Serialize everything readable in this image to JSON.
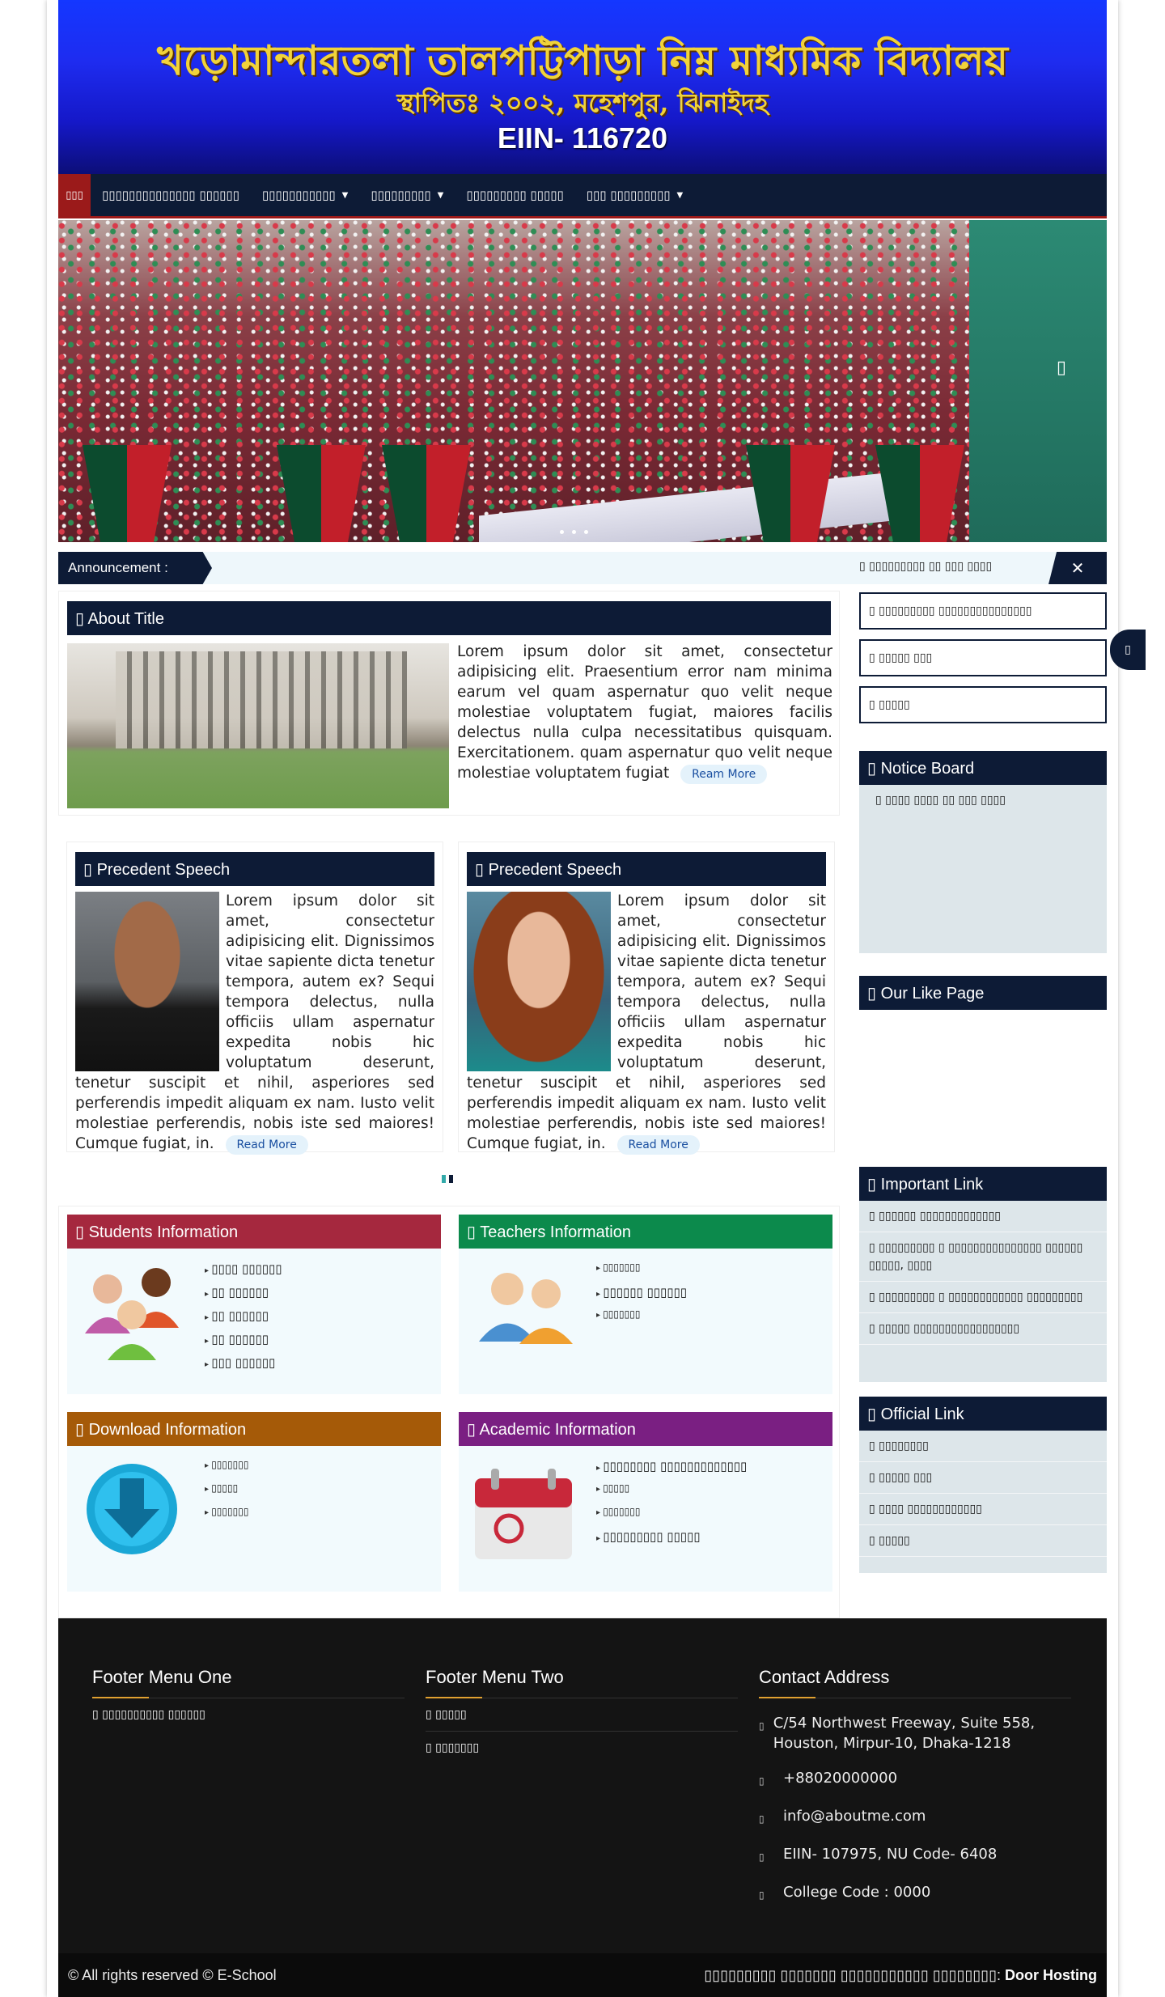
{
  "header": {
    "school_name": "খড়োমান্দারতলা তালপট্টিপাড়া নিম্ন মাধ্যমিক বিদ্যালয়",
    "established": "স্থাপিতঃ ২০০২, মহেশপুর, ঝিনাইদহ",
    "eiin": "EIIN- 116720"
  },
  "nav": {
    "home": "▯▯▯",
    "items": [
      {
        "label": "▯▯▯▯▯▯▯▯▯▯▯▯▯▯ ▯▯▯▯▯▯"
      },
      {
        "label": "▯▯▯▯▯▯▯▯▯▯▯",
        "caret": "▼"
      },
      {
        "label": "▯▯▯▯▯▯▯▯▯",
        "caret": "▼"
      },
      {
        "label": "▯▯▯▯▯▯▯▯▯ ▯▯▯▯▯"
      },
      {
        "label": "▯▯▯ ▯▯▯▯▯▯▯▯▯",
        "caret": "▼"
      }
    ]
  },
  "slider": {
    "next_icon": "▯"
  },
  "announcement": {
    "label": "Announcement :",
    "ticker": "▯ ▯▯▯▯▯▯▯▯▯ ▯▯ ▯▯▯ ▯▯▯▯",
    "close": "✕"
  },
  "about": {
    "title": "▯ About Title",
    "text": "Lorem ipsum dolor sit amet, consectetur adipisicing elit. Praesentium error nam minima earum vel quam aspernatur quo velit neque molestiae voluptatem fugiat, maiores facilis delectus nulla culpa necessitatibus quisquam. Exercitationem. quam aspernatur quo velit neque molestiae voluptatem fugiat",
    "read_more": "Ream More"
  },
  "speeches": [
    {
      "title": "▯ Precedent Speech",
      "text": "Lorem ipsum dolor sit amet, consectetur adipisicing elit. Dignissimos vitae sapiente dicta tenetur tempora, autem ex? Sequi tempora delectus, nulla officiis ullam aspernatur expedita nobis hic voluptatum deserunt, tenetur suscipit et nihil, asperiores sed perferendis impedit aliquam ex nam. Iusto velit molestiae perferendis, nobis iste sed maiores! Cumque fugiat, in.",
      "read_more": "Read More"
    },
    {
      "title": "▯ Precedent Speech",
      "text": "Lorem ipsum dolor sit amet, consectetur adipisicing elit. Dignissimos vitae sapiente dicta tenetur tempora, autem ex? Sequi tempora delectus, nulla officiis ullam aspernatur expedita nobis hic voluptatum deserunt, tenetur suscipit et nihil, asperiores sed perferendis impedit aliquam ex nam. Iusto velit molestiae perferendis, nobis iste sed maiores! Cumque fugiat, in.",
      "read_more": "Read More"
    }
  ],
  "info_cards": {
    "students": {
      "title": "▯ Students Information",
      "color": "#a5283e",
      "items": [
        "▯▯▯▯ ▯▯▯▯▯▯",
        "▯▯ ▯▯▯▯▯▯",
        "▯▯ ▯▯▯▯▯▯",
        "▯▯ ▯▯▯▯▯▯",
        "▯▯▯ ▯▯▯▯▯▯"
      ]
    },
    "teachers": {
      "title": "▯ Teachers Information",
      "color": "#0c8a4c",
      "items": [
        "▯▯▯▯▯▯▯",
        "▯▯▯▯▯▯ ▯▯▯▯▯▯",
        "▯▯▯▯▯▯▯"
      ]
    },
    "download": {
      "title": "▯ Download Information",
      "color": "#a55a08",
      "items": [
        "▯▯▯▯▯▯▯",
        "▯▯▯▯▯",
        "▯▯▯▯▯▯▯"
      ]
    },
    "academic": {
      "title": "▯ Academic Information",
      "color": "#7a1f82",
      "items": [
        "▯▯▯▯▯▯▯▯ ▯▯▯▯▯▯▯▯▯▯▯▯▯",
        "▯▯▯▯▯",
        "▯▯▯▯▯▯▯",
        "▯▯▯▯▯▯▯▯▯ ▯▯▯▯▯"
      ]
    }
  },
  "sidebar": {
    "buttons": [
      "▯ ▯▯▯▯▯▯▯▯▯ ▯▯▯▯▯▯▯▯▯▯▯▯▯▯▯",
      "▯ ▯▯▯▯▯ ▯▯▯",
      "▯ ▯▯▯▯▯"
    ],
    "notice": {
      "title": "▯ Notice Board",
      "items": [
        "▯ ▯▯▯▯ ▯▯▯▯ ▯▯ ▯▯▯ ▯▯▯▯"
      ]
    },
    "like_page": {
      "title": "▯ Our Like Page"
    },
    "important": {
      "title": "▯ Important Link",
      "items": [
        "▯ ▯▯▯▯▯▯ ▯▯▯▯▯▯▯▯▯▯▯▯▯",
        "▯ ▯▯▯▯▯▯▯▯▯ ▯ ▯▯▯▯▯▯▯▯▯▯▯▯▯▯▯ ▯▯▯▯▯▯ ▯▯▯▯▯, ▯▯▯▯",
        "▯ ▯▯▯▯▯▯▯▯▯ ▯ ▯▯▯▯▯▯▯▯▯▯▯▯ ▯▯▯▯▯▯▯▯▯",
        "▯ ▯▯▯▯▯ ▯▯▯▯▯▯▯▯▯▯▯▯▯▯▯▯▯"
      ]
    },
    "official": {
      "title": "▯ Official Link",
      "items": [
        "▯ ▯▯▯▯▯▯▯▯",
        "▯ ▯▯▯▯▯ ▯▯▯",
        "▯ ▯▯▯▯ ▯▯▯▯▯▯▯▯▯▯▯▯",
        "▯ ▯▯▯▯▯"
      ]
    },
    "float_icon": "▯"
  },
  "footer": {
    "menu_one": {
      "title": "Footer Menu One",
      "items": [
        "▯ ▯▯▯▯▯▯▯▯▯▯ ▯▯▯▯▯▯"
      ]
    },
    "menu_two": {
      "title": "Footer Menu Two",
      "items": [
        "▯ ▯▯▯▯▯",
        "▯ ▯▯▯▯▯▯▯"
      ]
    },
    "contact": {
      "title": "Contact Address",
      "lines": [
        "C/54 Northwest Freeway, Suite 558, Houston, Mirpur-10, Dhaka-1218",
        "+88020000000",
        "info@aboutme.com",
        "EIIN- 107975, NU Code- 6408",
        "College Code : 0000"
      ]
    }
  },
  "copyright": {
    "left": "© All rights reserved © E-School",
    "right_prefix": "▯▯▯▯▯▯▯▯▯ ▯▯▯▯▯▯▯ ▯▯▯▯▯▯▯▯▯▯▯ ▯▯▯▯▯▯▯▯:",
    "right_brand": "Door Hosting"
  }
}
